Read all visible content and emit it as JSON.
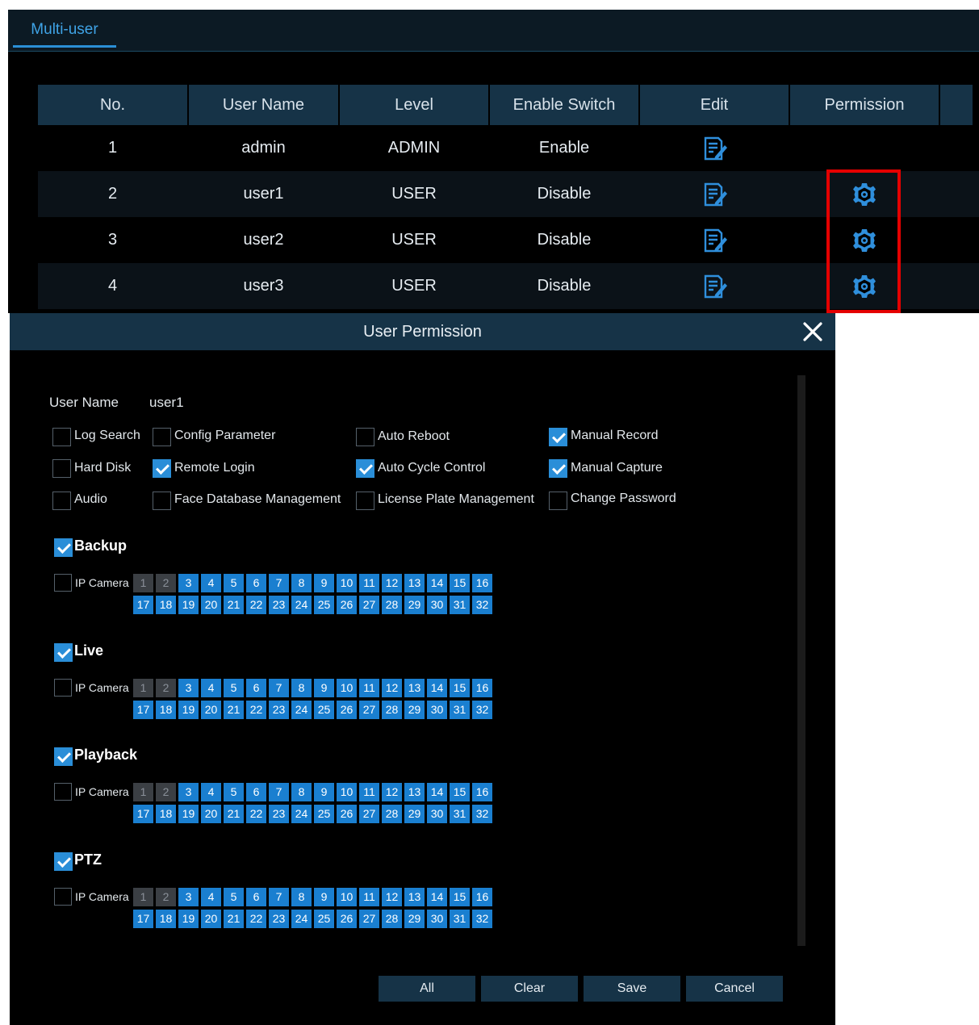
{
  "tabs": {
    "multi_user": "Multi-user"
  },
  "table": {
    "headers": [
      "No.",
      "User Name",
      "Level",
      "Enable Switch",
      "Edit",
      "Permission",
      ""
    ],
    "rows": [
      {
        "no": "1",
        "user": "admin",
        "level": "ADMIN",
        "enable": "Enable",
        "has_permission_icon": false
      },
      {
        "no": "2",
        "user": "user1",
        "level": "USER",
        "enable": "Disable",
        "has_permission_icon": true
      },
      {
        "no": "3",
        "user": "user2",
        "level": "USER",
        "enable": "Disable",
        "has_permission_icon": true
      },
      {
        "no": "4",
        "user": "user3",
        "level": "USER",
        "enable": "Disable",
        "has_permission_icon": true
      }
    ]
  },
  "dialog": {
    "title": "User Permission",
    "user_name_label": "User Name",
    "user_name_value": "user1",
    "options": {
      "log_search": {
        "label": "Log Search",
        "checked": false
      },
      "config_parameter": {
        "label": "Config Parameter",
        "checked": false
      },
      "auto_reboot": {
        "label": "Auto Reboot",
        "checked": false
      },
      "manual_record": {
        "label": "Manual Record",
        "checked": true
      },
      "hard_disk": {
        "label": "Hard Disk",
        "checked": false
      },
      "remote_login": {
        "label": "Remote Login",
        "checked": true
      },
      "auto_cycle_control": {
        "label": "Auto Cycle Control",
        "checked": true
      },
      "manual_capture": {
        "label": "Manual Capture",
        "checked": true
      },
      "audio": {
        "label": "Audio",
        "checked": false
      },
      "face_database_management": {
        "label": "Face Database Management",
        "checked": false
      },
      "license_plate_management": {
        "label": "License Plate Management",
        "checked": false
      },
      "change_password": {
        "label": "Change Password",
        "checked": false
      }
    },
    "sections": {
      "backup": {
        "label": "Backup",
        "checked": true
      },
      "live": {
        "label": "Live",
        "checked": true
      },
      "playback": {
        "label": "Playback",
        "checked": true
      },
      "ptz": {
        "label": "PTZ",
        "checked": true
      }
    },
    "ip_camera_label": "IP Camera",
    "channels_row1": [
      "1",
      "2",
      "3",
      "4",
      "5",
      "6",
      "7",
      "8",
      "9",
      "10",
      "11",
      "12",
      "13",
      "14",
      "15",
      "16"
    ],
    "channels_row2": [
      "17",
      "18",
      "19",
      "20",
      "21",
      "22",
      "23",
      "24",
      "25",
      "26",
      "27",
      "28",
      "29",
      "30",
      "31",
      "32"
    ],
    "disabled_channels": [
      "1",
      "2"
    ],
    "buttons": {
      "all": "All",
      "clear": "Clear",
      "save": "Save",
      "cancel": "Cancel"
    }
  },
  "colors": {
    "accent": "#2a8ed8",
    "header_bg": "#163347",
    "highlight": "#e50000"
  }
}
